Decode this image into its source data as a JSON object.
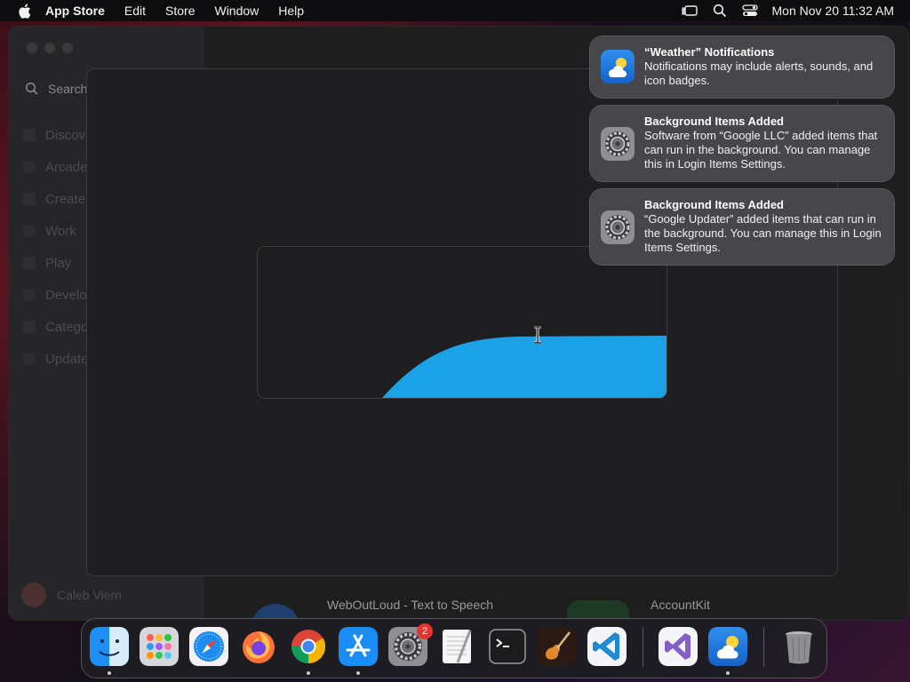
{
  "menubar": {
    "app_name": "App Store",
    "items": [
      "Edit",
      "Store",
      "Window",
      "Help"
    ],
    "clock": "Mon Nov 20  11:32 AM"
  },
  "sidebar": {
    "search_placeholder": "Search",
    "items": [
      "Discover",
      "Arcade",
      "Create",
      "Work",
      "Play",
      "Develop",
      "Categories",
      "Updates"
    ],
    "account_name": "Caleb Viern"
  },
  "background_apps": {
    "left_title": "WebOutLoud - Text to Speech",
    "right_title": "AccountKit"
  },
  "notifications": [
    {
      "app": "weather",
      "title": "“Weather” Notifications",
      "body": "Notifications may include alerts, sounds, and icon badges."
    },
    {
      "app": "system-settings",
      "title": "Background Items Added",
      "body": "Software from “Google LLC” added items that can run in the background. You can manage this in Login Items Settings."
    },
    {
      "app": "system-settings",
      "title": "Background Items Added",
      "body": "“Google Updater” added items that can run in the background. You can manage this in Login Items Settings."
    }
  ],
  "dock": {
    "apps": [
      "finder",
      "launchpad",
      "safari",
      "firefox",
      "chrome",
      "app-store",
      "system-settings",
      "textedit",
      "terminal",
      "garageband",
      "vscode",
      "visual-studio",
      "weather",
      "trash"
    ],
    "settings_badge": "2"
  },
  "colors": {
    "accent_blue": "#1ba1e6",
    "menubar_bg": "#0d0d0f",
    "notification_bg": "#48484c"
  }
}
